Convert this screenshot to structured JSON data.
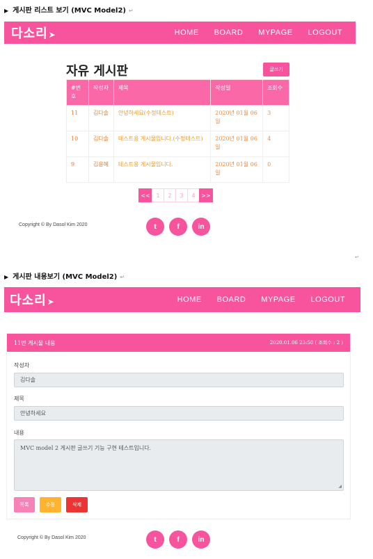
{
  "section1": {
    "heading": "게시판 리스트 보기 (MVC Model2)"
  },
  "section2": {
    "heading": "게시판 내용보기 (MVC Model2)"
  },
  "return_mark": "↵",
  "nav": {
    "logo": "다소리",
    "items": [
      "HOME",
      "BOARD",
      "MYPAGE",
      "LOGOUT"
    ]
  },
  "board": {
    "title": "자유 게시판",
    "write_button": "글쓰기",
    "columns": [
      "#번호",
      "작성자",
      "제목",
      "작성일",
      "조회수"
    ],
    "rows": [
      {
        "num": "11",
        "writer": "김다솔",
        "title": "안녕하세요(수정테스트)",
        "date": "2020년 01월 06일",
        "views": "3"
      },
      {
        "num": "10",
        "writer": "김다솔",
        "title": "테스트용 게시물입니다.(수정테스트)",
        "date": "2020년 01월 06일",
        "views": "4"
      },
      {
        "num": "9",
        "writer": "김용혜",
        "title": "테스트용 게시물입니다.",
        "date": "2020년 01월 06일",
        "views": "0"
      }
    ],
    "pagination": {
      "prev": "<<",
      "pages": [
        "1",
        "2",
        "3",
        "4"
      ],
      "next": ">>"
    }
  },
  "footer": {
    "copyright": "Copyright © By Dasol Kim 2020",
    "social": [
      "twitter-icon",
      "facebook-icon",
      "linkedin-icon"
    ],
    "social_glyphs": [
      "t",
      "f",
      "in"
    ]
  },
  "post": {
    "header_title": "11번 게시물 내용",
    "header_meta": "2020.01.06 23:50  ( 조회수 : 2 )",
    "writer_label": "작성자",
    "writer_value": "김다솔",
    "title_label": "제목",
    "title_value": "안녕하세요",
    "content_label": "내용",
    "content_value": "MVC model 2 게시판 글쓰기 기능 구현 테스트입니다.",
    "buttons": {
      "list": "목록",
      "edit": "수정",
      "delete": "삭제"
    }
  },
  "colors": {
    "accent": "#f8549e",
    "edit": "#ffb32f",
    "delete": "#ec3434"
  }
}
